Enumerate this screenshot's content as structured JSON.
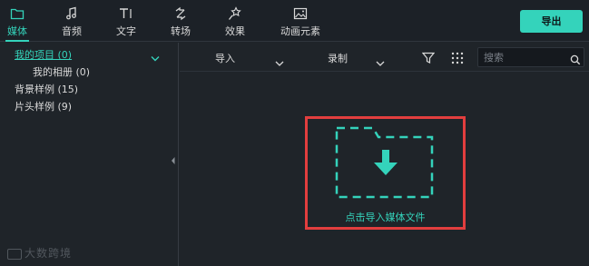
{
  "tabs": [
    {
      "label": "媒体",
      "icon": "folder-icon",
      "active": true
    },
    {
      "label": "音频",
      "icon": "music-note-icon",
      "active": false
    },
    {
      "label": "文字",
      "icon": "text-icon",
      "active": false
    },
    {
      "label": "转场",
      "icon": "transition-icon",
      "active": false
    },
    {
      "label": "效果",
      "icon": "effects-icon",
      "active": false
    },
    {
      "label": "动画元素",
      "icon": "image-icon",
      "active": false
    }
  ],
  "export_label": "导出",
  "sidebar": {
    "items": [
      {
        "label": "我的项目 (0)",
        "selected": true
      },
      {
        "label": "我的相册 (0)",
        "selected": false
      },
      {
        "label": "背景样例 (15)",
        "selected": false
      },
      {
        "label": "片头样例 (9)",
        "selected": false
      }
    ]
  },
  "toolbar": {
    "import_label": "导入",
    "record_label": "录制",
    "search_placeholder": "搜索"
  },
  "drop_zone": {
    "label": "点击导入媒体文件"
  },
  "watermark": "大数跨境",
  "colors": {
    "accent": "#34d3bb",
    "highlight_border": "#e23e3e",
    "background": "#1f2429"
  }
}
